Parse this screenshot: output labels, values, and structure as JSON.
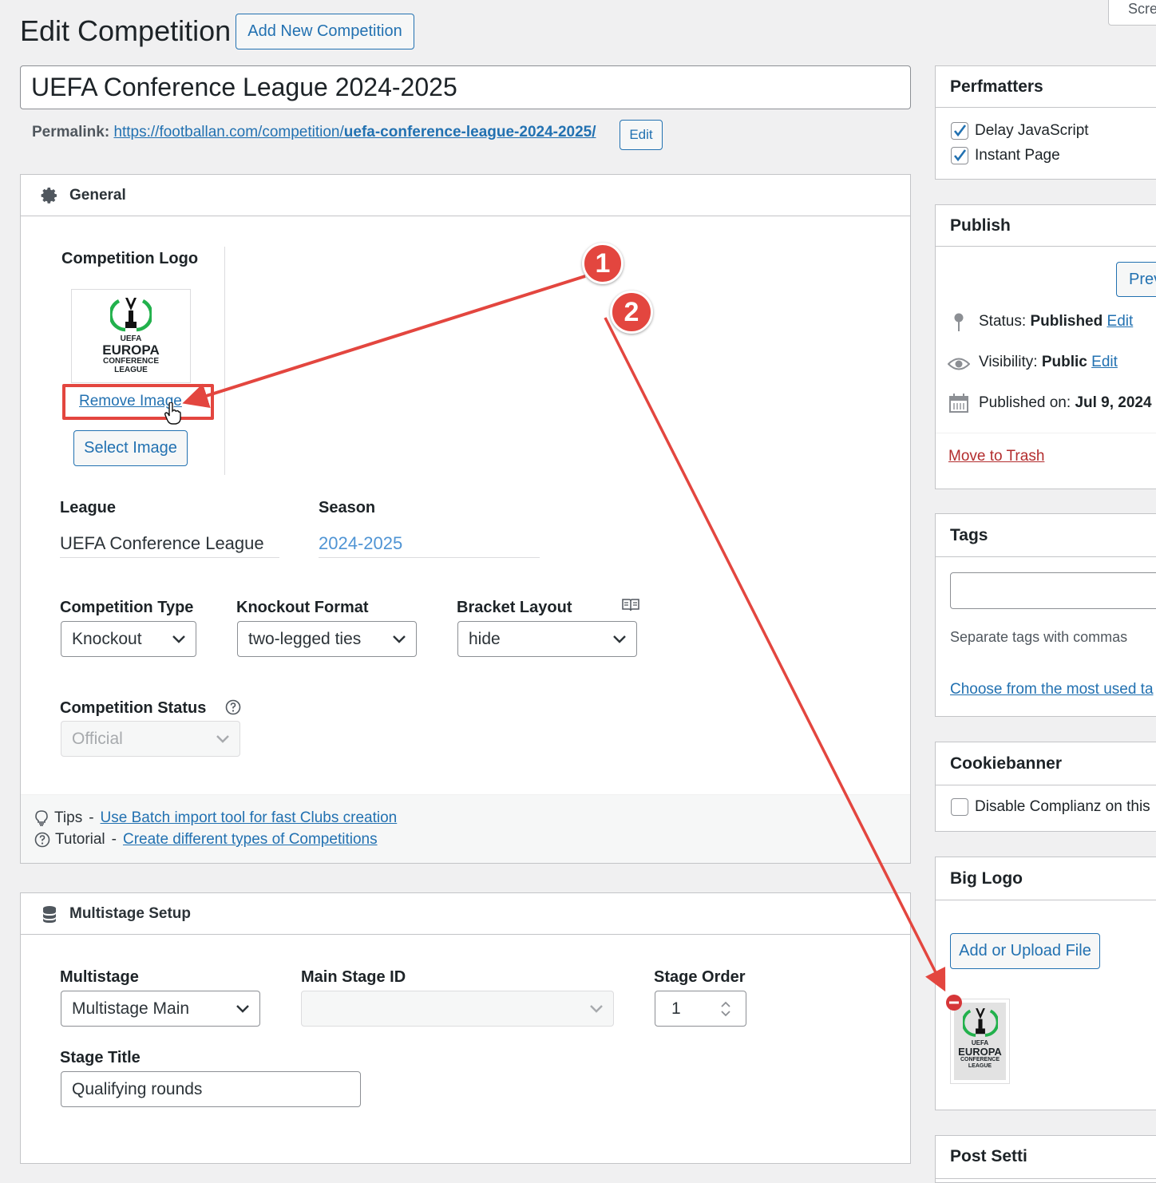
{
  "header": {
    "title": "Edit Competition",
    "add_new_label": "Add New Competition",
    "screen_options_label": "Scre"
  },
  "post": {
    "title_value": "UEFA Conference League 2024-2025",
    "permalink_label": "Permalink:",
    "permalink_base": "https://footballan.com/competition/",
    "permalink_slug": "uefa-conference-league-2024-2025/",
    "edit_label": "Edit"
  },
  "general": {
    "heading": "General",
    "logo_label": "Competition Logo",
    "logo_text_top": "UEFA",
    "logo_text_main": "EUROPA",
    "logo_text_sub": "CONFERENCE",
    "logo_text_bottom": "LEAGUE",
    "remove_image_label": "Remove Image",
    "select_image_label": "Select Image",
    "league_label": "League",
    "league_value": "UEFA Conference League",
    "season_label": "Season",
    "season_value": "2024-2025",
    "competition_type_label": "Competition Type",
    "competition_type_value": "Knockout",
    "knockout_format_label": "Knockout Format",
    "knockout_format_value": "two-legged ties",
    "bracket_layout_label": "Bracket Layout",
    "bracket_layout_value": "hide",
    "competition_status_label": "Competition Status",
    "competition_status_value": "Official",
    "tips_label": "Tips",
    "tips_link": "Use Batch import tool for fast Clubs creation",
    "tutorial_label": "Tutorial",
    "tutorial_link": "Create different types of Competitions"
  },
  "multistage": {
    "heading": "Multistage Setup",
    "multistage_label": "Multistage",
    "multistage_value": "Multistage Main",
    "main_stage_label": "Main Stage ID",
    "main_stage_value": "",
    "stage_order_label": "Stage Order",
    "stage_order_value": "1",
    "stage_title_label": "Stage Title",
    "stage_title_value": "Qualifying rounds"
  },
  "sidebar": {
    "perfmatters": {
      "heading": "Perfmatters",
      "delay_js_label": "Delay JavaScript",
      "instant_page_label": "Instant Page"
    },
    "publish": {
      "heading": "Publish",
      "preview_label": "Prev",
      "status_label": "Status:",
      "status_value": "Published",
      "visibility_label": "Visibility:",
      "visibility_value": "Public",
      "edit_label": "Edit",
      "published_on_label": "Published on:",
      "published_on_value": "Jul 9, 2024",
      "trash_label": "Move to Trash"
    },
    "tags": {
      "heading": "Tags",
      "hint": "Separate tags with commas",
      "choose_link": "Choose from the most used ta"
    },
    "cookiebanner": {
      "heading": "Cookiebanner",
      "disable_label": "Disable Complianz on this"
    },
    "big_logo": {
      "heading": "Big Logo",
      "add_upload_label": "Add or Upload File"
    },
    "post_settings": {
      "heading": "Post Setti"
    }
  },
  "annotations": {
    "marker_1": "1",
    "marker_2": "2"
  },
  "colors": {
    "accent": "#2271b1",
    "annotation_red": "#e3463f",
    "trash_red": "#b32d2e",
    "background": "#f0f0f1"
  }
}
